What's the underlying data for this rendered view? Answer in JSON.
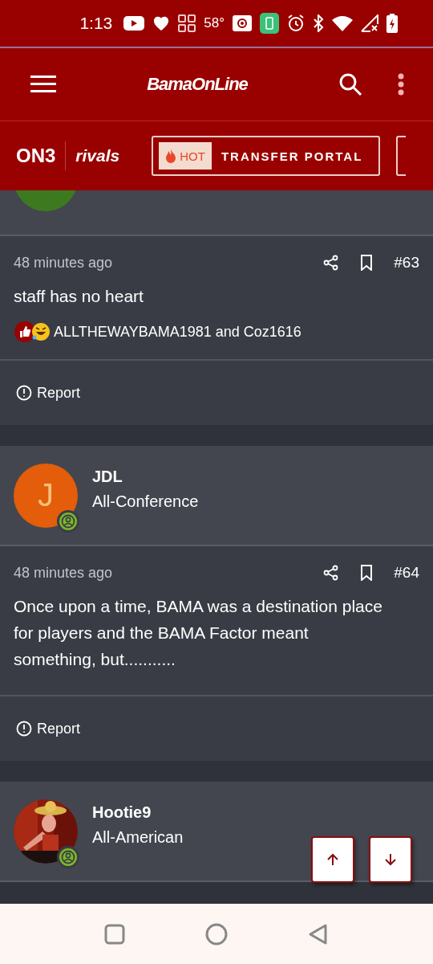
{
  "status_bar": {
    "time": "1:13",
    "temperature": "58°"
  },
  "header": {
    "logo": "BamaOnLine"
  },
  "nav": {
    "brand_left": "ON3",
    "brand_right": "rivals",
    "promo": {
      "badge": "HOT",
      "label": "TRANSFER PORTAL"
    }
  },
  "posts": [
    {
      "kind": "partial",
      "avatar": {
        "color": "#3d7a1f"
      }
    },
    {
      "kind": "post",
      "time": "48 minutes ago",
      "number": "#63",
      "body": "staff has no heart",
      "reactions": "ALLTHEWAYBAMA1981 and Coz1616",
      "report": "Report"
    },
    {
      "kind": "user",
      "name": "JDL",
      "rank": "All-Conference",
      "avatar": {
        "kind": "letter",
        "letter": "J",
        "color": "#e35d0a"
      }
    },
    {
      "kind": "post",
      "time": "48 minutes ago",
      "number": "#64",
      "body": "Once upon a time, BAMA was a destination place for players and the BAMA Factor meant something, but...........",
      "report": "Report"
    },
    {
      "kind": "user",
      "name": "Hootie9",
      "rank": "All-American"
    }
  ]
}
